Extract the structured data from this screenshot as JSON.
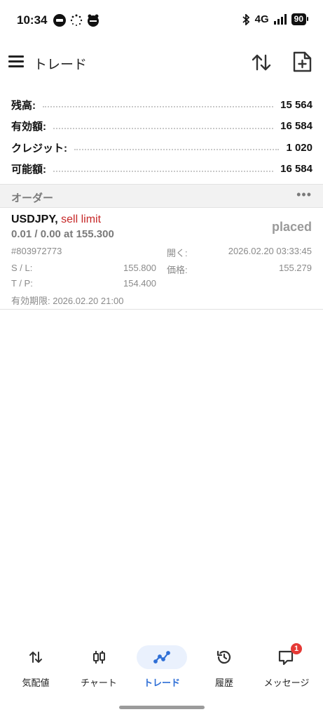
{
  "status_bar": {
    "time": "10:34",
    "network": "4G",
    "battery": "90",
    "icons": [
      "line-app-icon",
      "loading-dots-icon",
      "app-notification-icon",
      "bluetooth-icon",
      "signal-bars-icon",
      "battery-icon"
    ]
  },
  "app_bar": {
    "title": "トレード",
    "icons": [
      "menu-icon",
      "sort-icon",
      "new-order-icon"
    ]
  },
  "account": {
    "rows": [
      {
        "label": "残高:",
        "value": "15 564"
      },
      {
        "label": "有効額:",
        "value": "16 584"
      },
      {
        "label": "クレジット:",
        "value": "1 020"
      },
      {
        "label": "可能額:",
        "value": "16 584"
      }
    ]
  },
  "orders_section": {
    "title": "オーダー",
    "more": "•••"
  },
  "order": {
    "symbol": "USDJPY,",
    "type": "sell limit",
    "volume_price": "0.01 / 0.00 at 155.300",
    "status": "placed",
    "ticket": "#803972773",
    "open_label": "開く:",
    "open_time": "2026.02.20 03:33:45",
    "sl_label": "S / L:",
    "sl_value": "155.800",
    "price_label": "価格:",
    "price_value": "155.279",
    "tp_label": "T / P:",
    "tp_value": "154.400",
    "expiry": "有効期限: 2026.02.20 21:00"
  },
  "bottom_nav": {
    "items": [
      {
        "label": "気配値",
        "icon": "quotes-icon"
      },
      {
        "label": "チャート",
        "icon": "chart-candles-icon"
      },
      {
        "label": "トレード",
        "icon": "trade-icon",
        "active": true
      },
      {
        "label": "履歴",
        "icon": "history-icon"
      },
      {
        "label": "メッセージ",
        "icon": "messages-icon",
        "badge": "1"
      }
    ]
  },
  "colors": {
    "accent": "#2f6fd6",
    "sell": "#c62828",
    "badge": "#e53935"
  }
}
